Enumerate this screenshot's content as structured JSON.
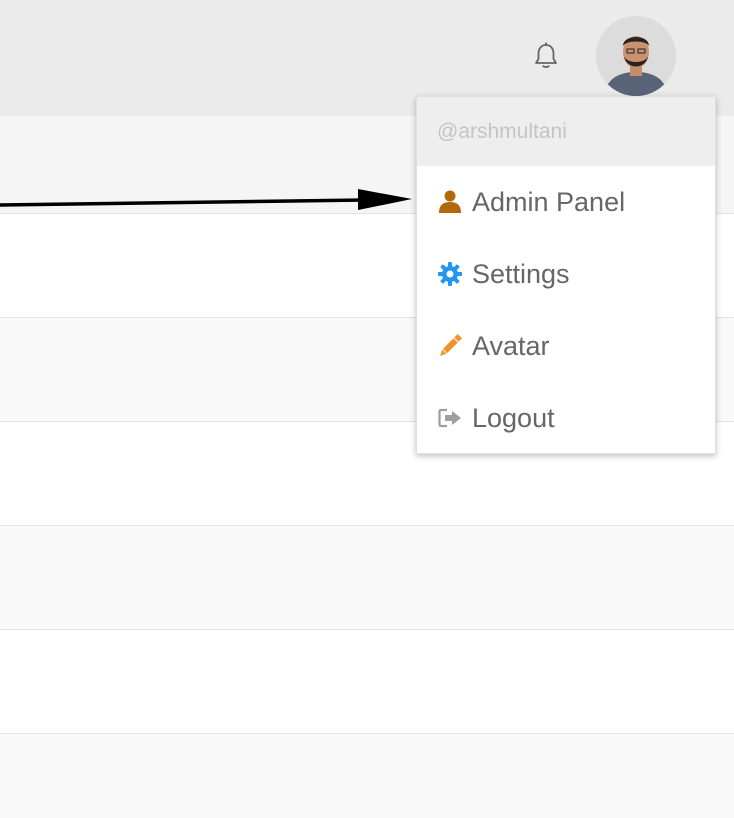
{
  "header": {
    "notifications_icon": "bell-icon",
    "avatar_label": "user-avatar"
  },
  "dropdown": {
    "username": "@arshmultani",
    "items": [
      {
        "label": "Admin Panel",
        "icon": "user-icon",
        "color": "#b06a0a"
      },
      {
        "label": "Settings",
        "icon": "gear-icon",
        "color": "#2196f3"
      },
      {
        "label": "Avatar",
        "icon": "pencil-icon",
        "color": "#f0932b"
      },
      {
        "label": "Logout",
        "icon": "sign-out-icon",
        "color": "#9e9e9e"
      }
    ]
  },
  "annotation": {
    "arrow_color": "#000000"
  }
}
